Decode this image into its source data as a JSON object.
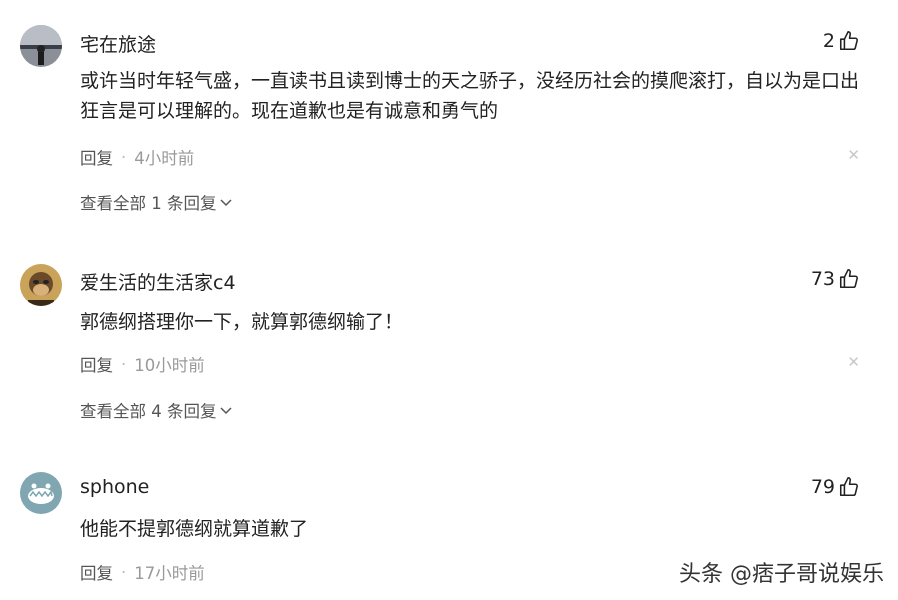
{
  "comments": [
    {
      "username": "宅在旅途",
      "likes": "2",
      "text": "或许当时年轻气盛，一直读书且读到博士的天之骄子，没经历社会的摸爬滚打，自以为是口出狂言是可以理解的。现在道歉也是有诚意和勇气的",
      "reply_label": "回复",
      "time": "4小时前",
      "view_all": "查看全部 1 条回复"
    },
    {
      "username": "爱生活的生活家c4",
      "likes": "73",
      "text": "郭德纲搭理你一下，就算郭德纲输了！",
      "reply_label": "回复",
      "time": "10小时前",
      "view_all": "查看全部 4 条回复"
    },
    {
      "username": "sphone",
      "likes": "79",
      "text": "他能不提郭德纲就算道歉了",
      "reply_label": "回复",
      "time": "17小时前"
    }
  ],
  "watermark": "头条 @痞子哥说娱乐",
  "icons": {
    "like": "thumbs-up-icon",
    "close": "close-icon",
    "expand": "chevron-down-icon"
  },
  "colors": {
    "text": "#222222",
    "meta": "#999999",
    "close": "#c8c8c8"
  }
}
